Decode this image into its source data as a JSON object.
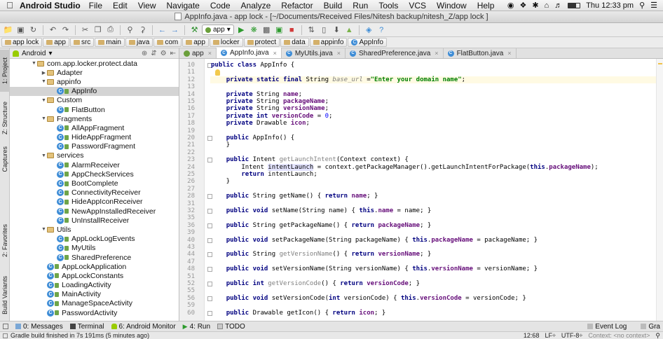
{
  "menubar": {
    "app_name": "Android Studio",
    "items": [
      "File",
      "Edit",
      "View",
      "Navigate",
      "Code",
      "Analyze",
      "Refactor",
      "Build",
      "Run",
      "Tools",
      "VCS",
      "Window",
      "Help"
    ],
    "clock": "Thu 12:33 pm"
  },
  "window": {
    "title": "AppInfo.java - app lock - [~/Documents/Received Files/Nitesh backup/nitesh_Z/app lock ]"
  },
  "toolbar": {
    "run_config": "app"
  },
  "breadcrumb": [
    "app lock",
    "app",
    "src",
    "main",
    "java",
    "com",
    "app",
    "locker",
    "protect",
    "data",
    "appinfo",
    "AppInfo"
  ],
  "left_tools": [
    "1: Project",
    "Z: Structure",
    "Captures",
    "2: Favorites",
    "Build Variants"
  ],
  "project": {
    "view_mode": "Android",
    "tree": [
      {
        "label": "com.app.locker.protect.data",
        "kind": "pkg",
        "indent": 0,
        "expanded": true
      },
      {
        "label": "Adapter",
        "kind": "pkg",
        "indent": 1,
        "expanded": false
      },
      {
        "label": "appinfo",
        "kind": "pkg",
        "indent": 1,
        "expanded": true
      },
      {
        "label": "AppInfo",
        "kind": "cls",
        "indent": 2,
        "selected": true
      },
      {
        "label": "Custom",
        "kind": "pkg",
        "indent": 1,
        "expanded": true
      },
      {
        "label": "FlatButton",
        "kind": "cls",
        "indent": 2
      },
      {
        "label": "Fragments",
        "kind": "pkg",
        "indent": 1,
        "expanded": true
      },
      {
        "label": "AllAppFragment",
        "kind": "cls",
        "indent": 2
      },
      {
        "label": "HideAppFragment",
        "kind": "cls",
        "indent": 2
      },
      {
        "label": "PasswordFragment",
        "kind": "cls",
        "indent": 2
      },
      {
        "label": "services",
        "kind": "pkg",
        "indent": 1,
        "expanded": true
      },
      {
        "label": "AlarmReceiver",
        "kind": "cls",
        "indent": 2
      },
      {
        "label": "AppCheckServices",
        "kind": "cls",
        "indent": 2
      },
      {
        "label": "BootComplete",
        "kind": "cls",
        "indent": 2
      },
      {
        "label": "ConnectivityReceiver",
        "kind": "cls",
        "indent": 2
      },
      {
        "label": "HideAppIconReceiver",
        "kind": "cls",
        "indent": 2
      },
      {
        "label": "NewAppInstalledReceiver",
        "kind": "cls",
        "indent": 2
      },
      {
        "label": "UnInstallReceiver",
        "kind": "cls",
        "indent": 2
      },
      {
        "label": "Utils",
        "kind": "pkg",
        "indent": 1,
        "expanded": true
      },
      {
        "label": "AppLockLogEvents",
        "kind": "cls",
        "indent": 2
      },
      {
        "label": "MyUtils",
        "kind": "cls",
        "indent": 2
      },
      {
        "label": "SharedPreference",
        "kind": "cls",
        "indent": 2
      },
      {
        "label": "AppLockApplication",
        "kind": "cls",
        "indent": 1
      },
      {
        "label": "AppLockConstants",
        "kind": "cls",
        "indent": 1
      },
      {
        "label": "LoadingActivity",
        "kind": "cls",
        "indent": 1
      },
      {
        "label": "MainActivity",
        "kind": "cls",
        "indent": 1
      },
      {
        "label": "ManageSpaceActivity",
        "kind": "cls",
        "indent": 1
      },
      {
        "label": "PasswordActivity",
        "kind": "cls",
        "indent": 1
      }
    ]
  },
  "editor": {
    "tabs": [
      {
        "label": "app",
        "kind": "app",
        "active": false
      },
      {
        "label": "AppInfo.java",
        "kind": "cls",
        "active": true
      },
      {
        "label": "MyUtils.java",
        "kind": "cls",
        "active": false
      },
      {
        "label": "SharedPreference.java",
        "kind": "cls",
        "active": false
      },
      {
        "label": "FlatButton.java",
        "kind": "cls",
        "active": false
      }
    ],
    "lines": [
      {
        "n": "10",
        "html": "<b>public class</b> AppInfo {"
      },
      {
        "n": "11",
        "html": ""
      },
      {
        "n": "12",
        "html": "    <b>private static final</b> String <span class=\"u it\">base_url</span> =<span class=\"s\">\"Enter your domain name\"</span>;",
        "hl": true
      },
      {
        "n": "13",
        "html": ""
      },
      {
        "n": "14",
        "html": "    <b>private</b> String <span class=\"f\">name</span>;"
      },
      {
        "n": "15",
        "html": "    <b>private</b> String <span class=\"f\">packageName</span>;"
      },
      {
        "n": "16",
        "html": "    <b>private</b> String <span class=\"f\">versionName</span>;"
      },
      {
        "n": "17",
        "html": "    <b>private int</b> <span class=\"f\">versionCode</span> = <span class=\"n\">0</span>;"
      },
      {
        "n": "18",
        "html": "    <b>private</b> Drawable <span class=\"f\">icon</span>;"
      },
      {
        "n": "19",
        "html": ""
      },
      {
        "n": "20",
        "html": "    <b>public</b> AppInfo() {"
      },
      {
        "n": "21",
        "html": "    }"
      },
      {
        "n": "22",
        "html": ""
      },
      {
        "n": "23",
        "html": "    <b>public</b> Intent <span class=\"u\">getLaunchIntent</span>(Context context) {"
      },
      {
        "n": "24",
        "html": "        Intent <span class=\"hv\">intentLaunch</span> = context.getPackageManager().getLaunchIntentForPackage(<b>this</b>.<span class=\"f\">packageName</span>);"
      },
      {
        "n": "25",
        "html": "        <b>return</b> intentLaunch;"
      },
      {
        "n": "26",
        "html": "    }"
      },
      {
        "n": "27",
        "html": ""
      },
      {
        "n": "28",
        "html": "    <b>public</b> String getName() { <b>return</b> <span class=\"f\">name</span>; }"
      },
      {
        "n": "31",
        "html": ""
      },
      {
        "n": "32",
        "html": "    <b>public void</b> setName(String name) { <b>this</b>.<span class=\"f\">name</span> = name; }"
      },
      {
        "n": "35",
        "html": ""
      },
      {
        "n": "36",
        "html": "    <b>public</b> String getPackageName() { <b>return</b> <span class=\"f\">packageName</span>; }"
      },
      {
        "n": "39",
        "html": ""
      },
      {
        "n": "40",
        "html": "    <b>public void</b> setPackageName(String packageName) { <b>this</b>.<span class=\"f\">packageName</span> = packageName; }"
      },
      {
        "n": "43",
        "html": ""
      },
      {
        "n": "44",
        "html": "    <b>public</b> String <span class=\"u\">getVersionName</span>() { <b>return</b> <span class=\"f\">versionName</span>; }"
      },
      {
        "n": "47",
        "html": ""
      },
      {
        "n": "48",
        "html": "    <b>public void</b> setVersionName(String versionName) { <b>this</b>.<span class=\"f\">versionName</span> = versionName; }"
      },
      {
        "n": "51",
        "html": ""
      },
      {
        "n": "52",
        "html": "    <b>public int</b> <span class=\"u\">getVersionCode</span>() { <b>return</b> <span class=\"f\">versionCode</span>; }"
      },
      {
        "n": "55",
        "html": ""
      },
      {
        "n": "56",
        "html": "    <b>public void</b> setVersionCode(<b>int</b> versionCode) { <b>this</b>.<span class=\"f\">versionCode</span> = versionCode; }"
      },
      {
        "n": "59",
        "html": ""
      },
      {
        "n": "60",
        "html": "    <b>public</b> Drawable getIcon() { <b>return</b> <span class=\"f\">icon</span>; }"
      }
    ]
  },
  "bottom_tools": {
    "left": [
      "0: Messages",
      "Terminal",
      "6: Android Monitor",
      "4: Run",
      "TODO"
    ],
    "right": [
      "Event Log",
      "Gra"
    ]
  },
  "status": {
    "message": "Gradle build finished in 7s 191ms (5 minutes ago)",
    "position": "12:68",
    "line_sep": "LF÷",
    "encoding": "UTF-8÷",
    "context": "Context: <no context>"
  }
}
